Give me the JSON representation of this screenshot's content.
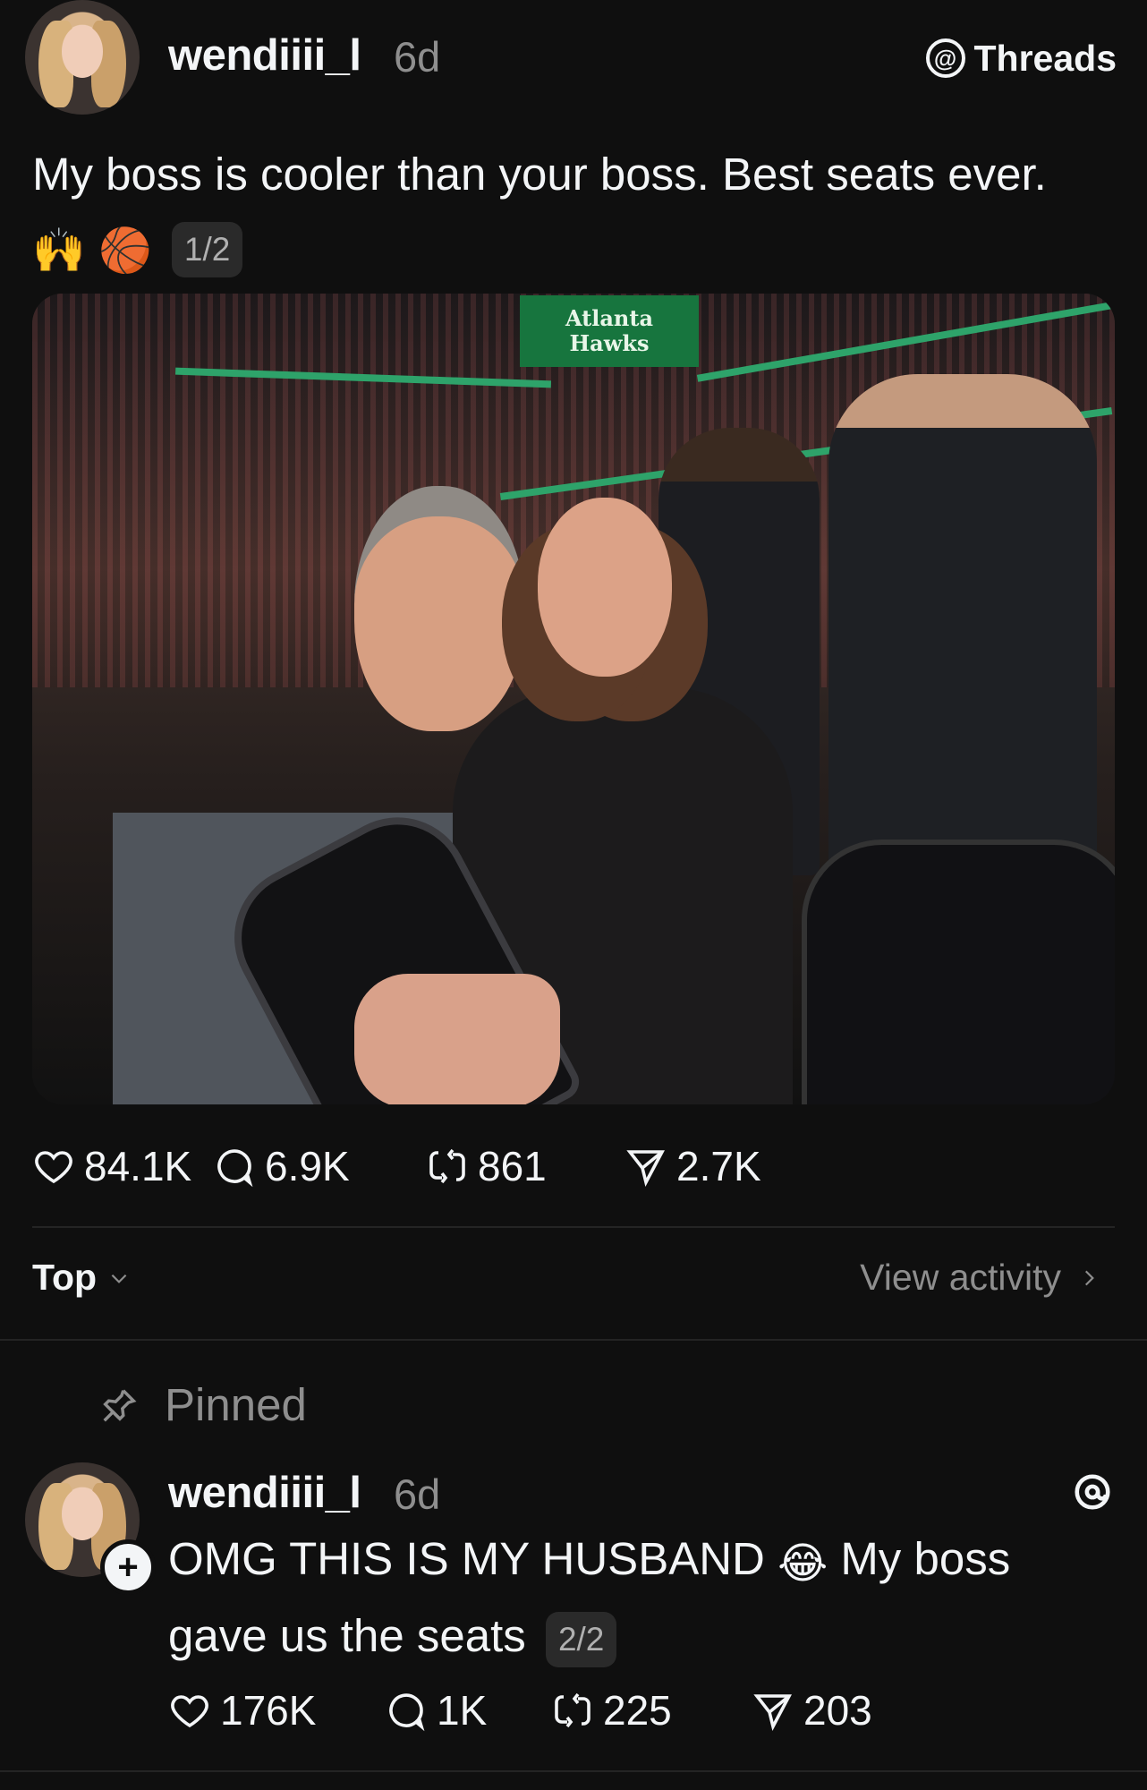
{
  "post": {
    "username": "wendiiii_l",
    "time": "6d",
    "badge_label": "Threads",
    "text": "My boss is cooler than your boss. Best seats ever.",
    "emojis": [
      "🙌",
      "🏀"
    ],
    "counter": "1/2",
    "photo": {
      "scoreboard_line1": "Atlanta",
      "scoreboard_line2": "Hawks"
    },
    "stats": {
      "likes": "84.1K",
      "replies": "6.9K",
      "reposts": "861",
      "shares": "2.7K"
    }
  },
  "sort_bar": {
    "sort_label": "Top",
    "view_activity_label": "View activity"
  },
  "pinned_label": "Pinned",
  "reply": {
    "username": "wendiiii_l",
    "time": "6d",
    "text_part1": "OMG THIS IS MY HUSBAND",
    "emoji": "😂",
    "text_part2": "My boss gave us the seats",
    "counter": "2/2",
    "stats": {
      "likes": "176K",
      "replies": "1K",
      "reposts": "225",
      "shares": "203"
    }
  },
  "icons": {
    "like": "heart-icon",
    "reply": "comment-icon",
    "repost": "repost-icon",
    "share": "send-icon",
    "pin": "pin-icon",
    "threads": "threads-logo-icon"
  },
  "colors": {
    "background": "#0f0f0f",
    "text": "#f3f5f7",
    "muted": "#8e8e8e"
  }
}
